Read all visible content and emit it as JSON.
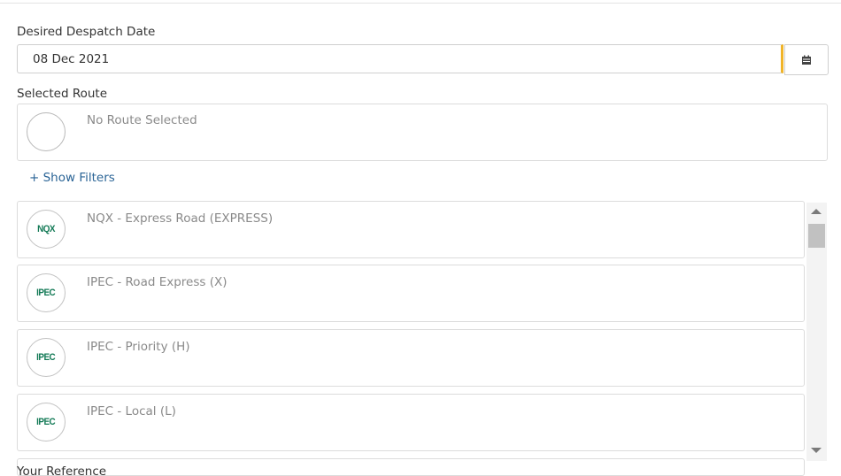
{
  "despatch": {
    "label": "Desired Despatch Date",
    "value": "08 Dec 2021"
  },
  "selected_route": {
    "label": "Selected Route",
    "text": "No Route Selected"
  },
  "filters": {
    "toggle_label": "+ Show Filters"
  },
  "routes": [
    {
      "logo": "NQX",
      "name": "NQX - Express Road (EXPRESS)"
    },
    {
      "logo": "IPEC",
      "name": "IPEC - Road Express (X)"
    },
    {
      "logo": "IPEC",
      "name": "IPEC - Priority (H)"
    },
    {
      "logo": "IPEC",
      "name": "IPEC - Local (L)"
    }
  ],
  "reference": {
    "label": "Your Reference"
  },
  "colors": {
    "accent": "#f0b429",
    "link": "#2a6496",
    "logo": "#137a56"
  },
  "icons": {
    "calendar_button": "calendar-icon",
    "scroll_up": "scroll-up-arrow-icon",
    "scroll_down": "scroll-down-arrow-icon"
  }
}
